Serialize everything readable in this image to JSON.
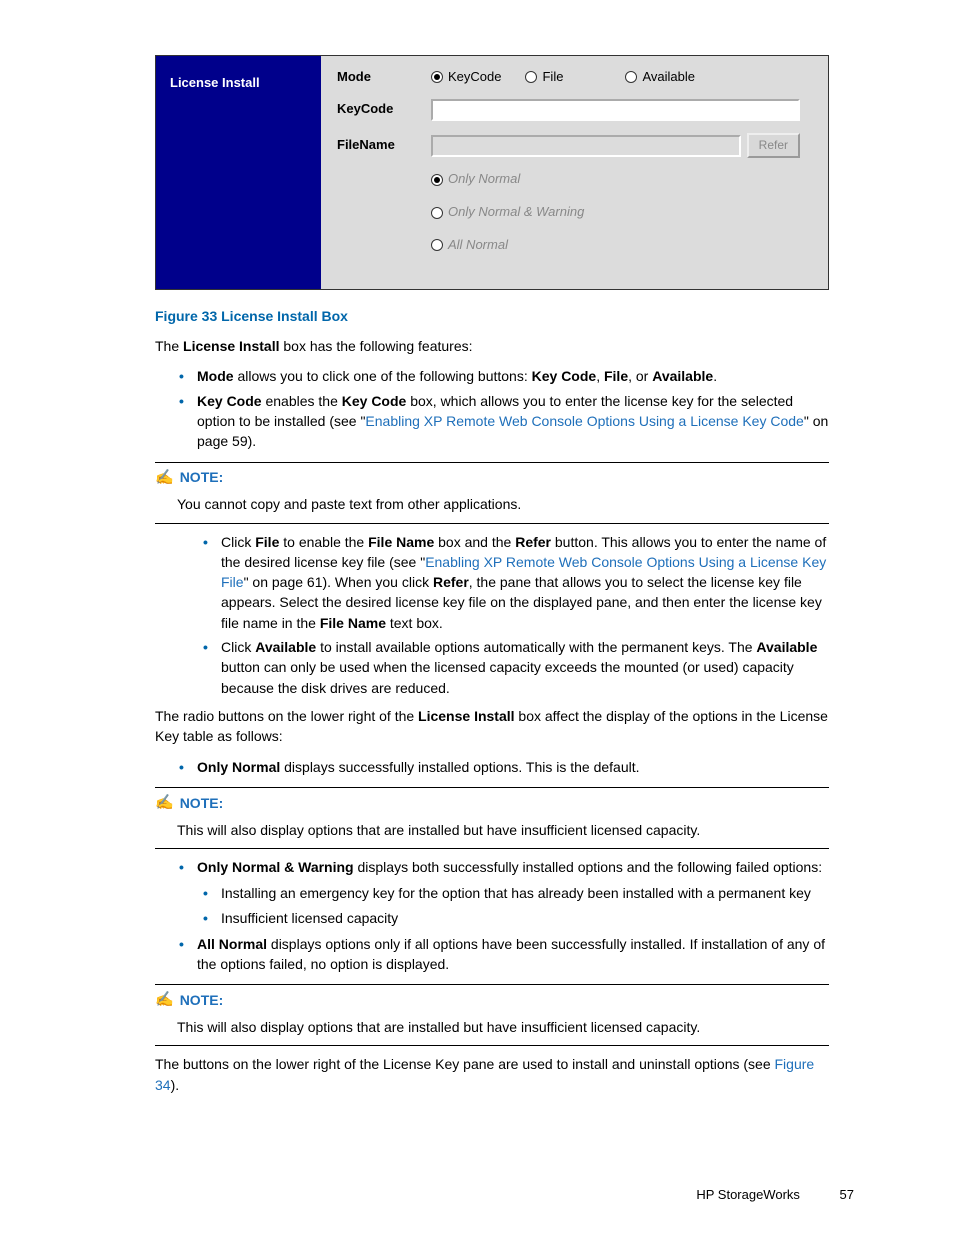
{
  "shot": {
    "title": "License Install",
    "labels": {
      "mode": "Mode",
      "keycode": "KeyCode",
      "filename": "FileName"
    },
    "modeOptions": [
      {
        "name": "keycode",
        "label": "KeyCode",
        "selected": true
      },
      {
        "name": "file",
        "label": "File",
        "selected": false
      },
      {
        "name": "available",
        "label": "Available",
        "selected": false
      }
    ],
    "referBtn": "Refer",
    "filterOptions": [
      {
        "name": "only-normal",
        "label": "Only Normal",
        "selected": true
      },
      {
        "name": "only-normal-warning",
        "label": "Only Normal & Warning",
        "selected": false
      },
      {
        "name": "all-normal",
        "label": "All Normal",
        "selected": false
      }
    ]
  },
  "figureCaption": "Figure 33 License Install Box",
  "intro": {
    "pre": "The ",
    "b": "License Install",
    "post": " box has the following features:"
  },
  "topBullets": {
    "mode": {
      "b": "Mode",
      "mid": " allows you to click one of the following buttons: ",
      "kc": "Key Code",
      "c1": ", ",
      "file": "File",
      "c2": ", or ",
      "avail": "Available",
      "end": "."
    },
    "keycode": {
      "b": "Key Code",
      "mid": " enables the ",
      "kc": "Key Code",
      "post": " box, which allows you to enter the license key for the selected option to be installed (see \"",
      "link": "Enabling XP Remote Web Console Options Using a License Key Code",
      "tail": "\" on page 59)."
    }
  },
  "note1": {
    "label": "NOTE:",
    "body": "You cannot copy and paste text from other applications."
  },
  "mid": {
    "file": {
      "pre": "Click ",
      "fileB": "File",
      "mid1": " to enable the ",
      "fnB": "File Name",
      "mid2": " box and the ",
      "referB": "Refer",
      "mid3": " button. This allows you to enter the name of the desired license key file (see \"",
      "link": "Enabling XP Remote Web Console Options Using a License Key File",
      "mid4": "\" on page 61). When you click ",
      "referB2": "Refer",
      "mid5": ", the pane that allows you to select the license key file appears. Select the desired license key file on the displayed pane, and then enter the license key file name in the ",
      "fnB2": "File Name",
      "end": " text box."
    },
    "avail": {
      "pre": "Click ",
      "availB": "Available",
      "mid": " to install available options automatically with the permanent keys. The ",
      "availB2": "Available",
      "end": " button can only be used when the licensed capacity exceeds the mounted (or used) capacity because the disk drives are reduced."
    }
  },
  "radioIntro": {
    "pre": "The radio buttons on the lower right of the ",
    "b": "License Install",
    "post": " box affect the display of the options in the License Key table as follows:"
  },
  "onlyNormal": {
    "b": "Only Normal",
    "txt": " displays successfully installed options. This is the default."
  },
  "note2": {
    "label": "NOTE:",
    "body": "This will also display options that are installed but have insufficient licensed capacity."
  },
  "onlyNW": {
    "b": "Only Normal & Warning",
    "txt": " displays both successfully installed options and the following failed options:"
  },
  "nwSubs": [
    "Installing an emergency key for the option that has already been installed with a permanent key",
    "Insufficient licensed capacity"
  ],
  "allNormal": {
    "b": "All Normal",
    "txt": " displays options only if all options have been successfully installed. If installation of any of the options failed, no option is displayed."
  },
  "note3": {
    "label": "NOTE:",
    "body": "This will also display options that are installed but have insufficient licensed capacity."
  },
  "closing": {
    "pre": "The buttons on the lower right of the License Key pane are used to install and uninstall options (see ",
    "link": "Figure 34",
    "post": ")."
  },
  "footer": {
    "label": "HP StorageWorks",
    "page": "57"
  }
}
